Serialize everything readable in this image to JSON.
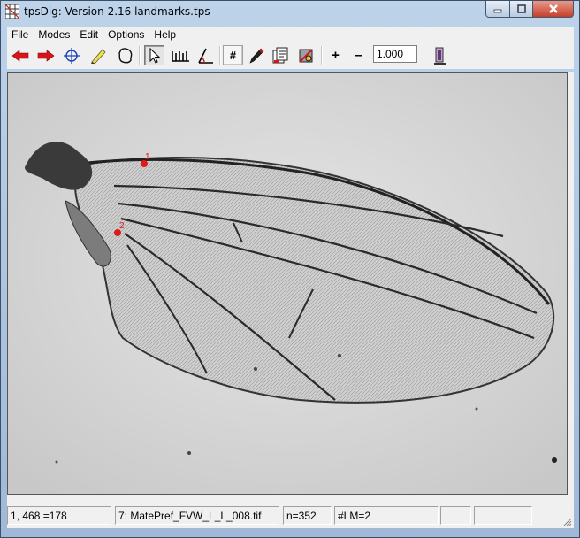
{
  "window": {
    "title": "tpsDig: Version 2.16 landmarks.tps",
    "app_icon": "grid-icon",
    "controls": {
      "minimize": "minimize-icon",
      "maximize": "maximize-icon",
      "close": "close-icon"
    }
  },
  "menu": {
    "items": [
      {
        "label": "File"
      },
      {
        "label": "Modes"
      },
      {
        "label": "Edit"
      },
      {
        "label": "Options"
      },
      {
        "label": "Help"
      }
    ]
  },
  "toolbar": {
    "tools": [
      "previous-image-icon",
      "next-image-icon",
      "landmark-crosshair-icon",
      "pencil-icon",
      "outline-icon",
      "select-arrow-icon",
      "ruler-icon",
      "angle-icon",
      "number-icon",
      "marker-pen-icon",
      "data-file-icon",
      "image-tools-icon",
      "zoom-in-icon",
      "zoom-out-icon",
      "scale-icon"
    ],
    "hash_label": "#",
    "zoom_in_label": "+",
    "zoom_out_label": "–",
    "zoom_value": "1.000"
  },
  "canvas": {
    "landmarks": [
      {
        "label": "1"
      },
      {
        "label": "2"
      }
    ],
    "landmark_color": "#e01a1a"
  },
  "status": {
    "coords": "1, 468 =178",
    "file": "7: MatePref_FVW_L_L_008.tif",
    "count": "n=352",
    "landmarks": "#LM=2",
    "extra1": "",
    "extra2": ""
  }
}
